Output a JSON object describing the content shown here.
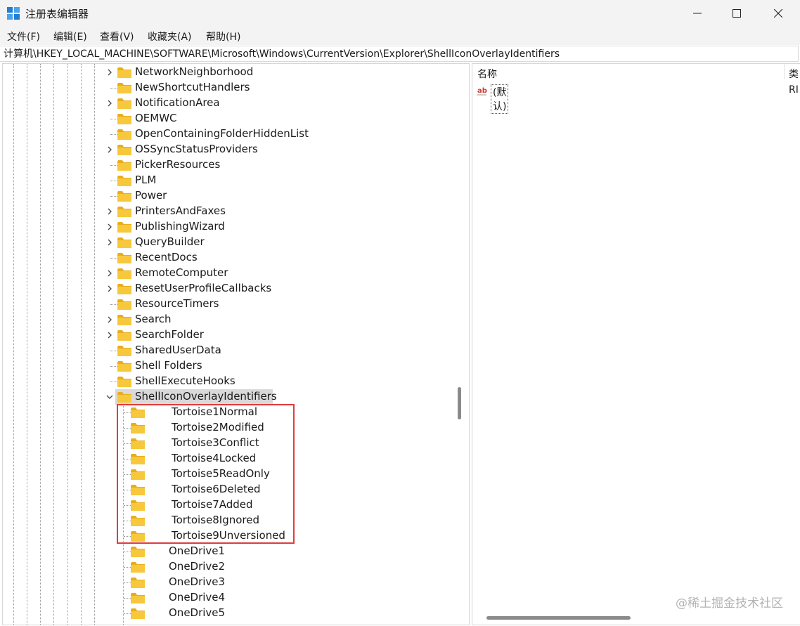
{
  "window": {
    "title": "注册表编辑器"
  },
  "menu": [
    "文件(F)",
    "编辑(E)",
    "查看(V)",
    "收藏夹(A)",
    "帮助(H)"
  ],
  "address": "计算机\\HKEY_LOCAL_MACHINE\\SOFTWARE\\Microsoft\\Windows\\CurrentVersion\\Explorer\\ShellIconOverlayIdentifiers",
  "tree": [
    {
      "label": "NetworkNeighborhood",
      "expandable": true
    },
    {
      "label": "NewShortcutHandlers",
      "expandable": false
    },
    {
      "label": "NotificationArea",
      "expandable": true
    },
    {
      "label": "OEMWC",
      "expandable": false
    },
    {
      "label": "OpenContainingFolderHiddenList",
      "expandable": false
    },
    {
      "label": "OSSyncStatusProviders",
      "expandable": true
    },
    {
      "label": "PickerResources",
      "expandable": false
    },
    {
      "label": "PLM",
      "expandable": false
    },
    {
      "label": "Power",
      "expandable": false
    },
    {
      "label": "PrintersAndFaxes",
      "expandable": true
    },
    {
      "label": "PublishingWizard",
      "expandable": true
    },
    {
      "label": "QueryBuilder",
      "expandable": true
    },
    {
      "label": "RecentDocs",
      "expandable": false
    },
    {
      "label": "RemoteComputer",
      "expandable": true
    },
    {
      "label": "ResetUserProfileCallbacks",
      "expandable": true
    },
    {
      "label": "ResourceTimers",
      "expandable": false
    },
    {
      "label": "Search",
      "expandable": true
    },
    {
      "label": "SearchFolder",
      "expandable": true
    },
    {
      "label": "SharedUserData",
      "expandable": false
    },
    {
      "label": "Shell Folders",
      "expandable": false
    },
    {
      "label": "ShellExecuteHooks",
      "expandable": false
    },
    {
      "label": "ShellIconOverlayIdentifiers",
      "expandable": true,
      "expanded": true,
      "selected": true
    }
  ],
  "children": [
    "Tortoise1Normal",
    "Tortoise2Modified",
    "Tortoise3Conflict",
    "Tortoise4Locked",
    "Tortoise5ReadOnly",
    "Tortoise6Deleted",
    "Tortoise7Added",
    "Tortoise8Ignored",
    "Tortoise9Unversioned",
    "OneDrive1",
    "OneDrive2",
    "OneDrive3",
    "OneDrive4",
    "OneDrive5"
  ],
  "values_pane": {
    "columns": [
      "名称",
      "类"
    ],
    "rows": [
      {
        "name": "(默认)",
        "type": "RI"
      }
    ]
  },
  "watermark": "@稀土掘金技术社区",
  "colors": {
    "folder": "#f8c83c",
    "folder_dark": "#e9ad1a",
    "highlight": "#e23b3b",
    "selected": "#d9d9d9"
  }
}
